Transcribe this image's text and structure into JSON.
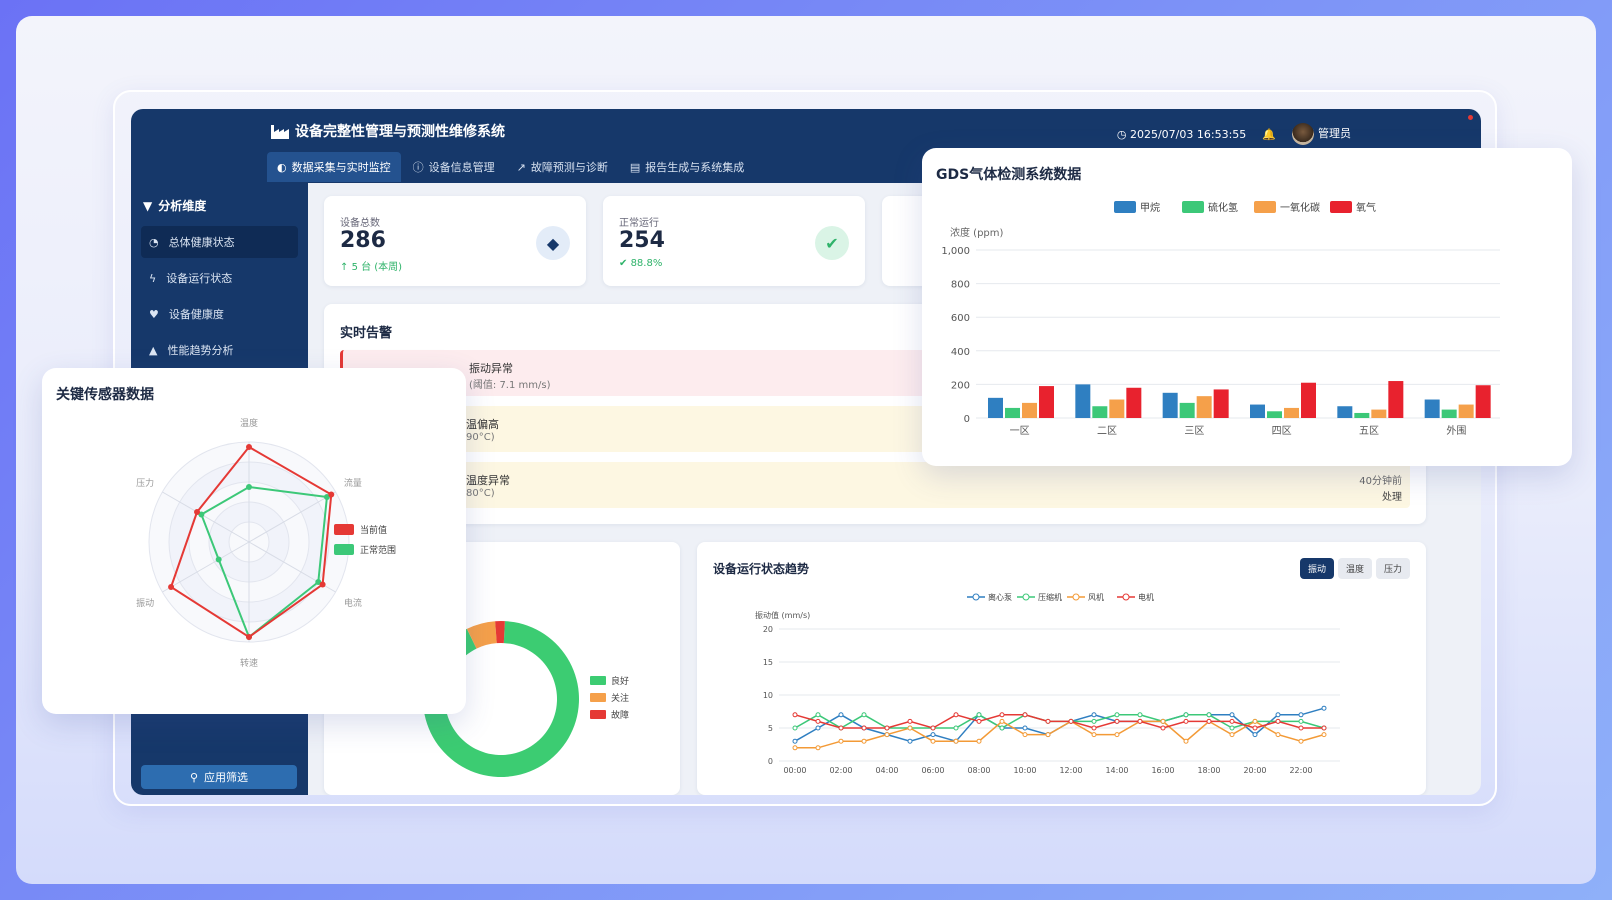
{
  "app": {
    "title": "设备完整性管理与预测性维修系统",
    "datetime": "2025/07/03 16:53:55",
    "user": "管理员"
  },
  "tabs": [
    {
      "label": "数据采集与实时监控",
      "icon": "dashboard-icon",
      "active": true
    },
    {
      "label": "设备信息管理",
      "icon": "info-icon"
    },
    {
      "label": "故障预测与诊断",
      "icon": "line-chart-icon"
    },
    {
      "label": "报告生成与系统集成",
      "icon": "document-icon"
    }
  ],
  "sidebar": {
    "title": "分析维度",
    "items": [
      {
        "label": "总体健康状态",
        "icon": "gauge-icon",
        "active": true
      },
      {
        "label": "设备运行状态",
        "icon": "bolt-icon"
      },
      {
        "label": "设备健康度",
        "icon": "heartbeat-icon"
      },
      {
        "label": "性能趋势分析",
        "icon": "area-chart-icon"
      }
    ],
    "apply_button": "应用筛选"
  },
  "stats": [
    {
      "label": "设备总数",
      "value": "286",
      "sub": "5 台 (本周)",
      "icon": "cubes-icon"
    },
    {
      "label": "正常运行",
      "value": "254",
      "sub": "88.8%",
      "icon": "check-icon"
    }
  ],
  "alerts": {
    "title": "实时告警",
    "items": [
      {
        "title": "振动异常",
        "detail": "(阈值: 7.1 mm/s)",
        "time": "",
        "action": "",
        "color": "#fdecee"
      },
      {
        "title": "温偏高",
        "detail": "90°C)",
        "time": "",
        "action": "",
        "color": "#fdf7e2"
      },
      {
        "title": "温度异常",
        "detail": "80°C)",
        "time": "40分钟前",
        "action": "处理",
        "color": "#fdf7e2"
      }
    ]
  },
  "donut": {
    "legend": [
      "良好",
      "关注",
      "故障"
    ],
    "values": [
      92,
      6,
      2
    ],
    "colors": [
      "#3ccc72",
      "#f5a04a",
      "#e53935"
    ]
  },
  "trend": {
    "title": "设备运行状态趋势",
    "buttons": [
      "振动",
      "温度",
      "压力"
    ],
    "ylabel": "振动值 (mm/s)",
    "ylim": [
      0,
      20
    ],
    "yticks": [
      "0",
      "5",
      "10",
      "15",
      "20"
    ],
    "xticks": [
      "00:00",
      "02:00",
      "04:00",
      "06:00",
      "08:00",
      "10:00",
      "12:00",
      "14:00",
      "16:00",
      "18:00",
      "20:00",
      "22:00"
    ],
    "series": [
      {
        "name": "离心泵",
        "color": "#2f7fc1",
        "values": [
          3,
          5,
          7,
          5,
          4,
          3,
          4,
          3,
          7,
          5,
          5,
          4,
          6,
          7,
          6,
          6,
          6,
          7,
          7,
          7,
          4,
          7,
          7,
          8
        ]
      },
      {
        "name": "压缩机",
        "color": "#3cc878",
        "values": [
          5,
          7,
          5,
          7,
          5,
          5,
          5,
          5,
          7,
          5,
          7,
          6,
          6,
          6,
          7,
          7,
          6,
          7,
          7,
          5,
          6,
          6,
          6,
          5
        ]
      },
      {
        "name": "风机",
        "color": "#f39a36",
        "values": [
          2,
          2,
          3,
          3,
          4,
          5,
          3,
          3,
          3,
          6,
          4,
          4,
          6,
          4,
          4,
          6,
          6,
          3,
          6,
          4,
          6,
          4,
          3,
          4
        ]
      },
      {
        "name": "电机",
        "color": "#e53935",
        "values": [
          7,
          6,
          5,
          5,
          5,
          6,
          5,
          7,
          6,
          7,
          7,
          6,
          6,
          5,
          6,
          6,
          5,
          6,
          6,
          6,
          5,
          6,
          5,
          5
        ]
      }
    ]
  },
  "gds": {
    "title": "GDS气体检测系统数据",
    "ylabel": "浓度 (ppm)",
    "ylim": [
      0,
      1000
    ],
    "yticks": [
      "0",
      "200",
      "400",
      "600",
      "800",
      "1,000"
    ],
    "chart_data": {
      "type": "bar",
      "categories": [
        "一区",
        "二区",
        "三区",
        "四区",
        "五区",
        "外围"
      ],
      "ylabel": "浓度 (ppm)",
      "ylim": [
        0,
        1000
      ],
      "series": [
        {
          "name": "甲烷",
          "color": "#2f7fc1",
          "values": [
            120,
            200,
            150,
            80,
            70,
            110
          ]
        },
        {
          "name": "硫化氢",
          "color": "#3cc878",
          "values": [
            60,
            70,
            90,
            40,
            30,
            50
          ]
        },
        {
          "name": "一氧化碳",
          "color": "#f5a04a",
          "values": [
            90,
            110,
            130,
            60,
            50,
            80
          ]
        },
        {
          "name": "氧气",
          "color": "#e8222e",
          "values": [
            190,
            180,
            170,
            210,
            220,
            195
          ]
        }
      ]
    }
  },
  "radar": {
    "title": "关键传感器数据",
    "axes": [
      "温度",
      "流量",
      "电流",
      "转速",
      "振动",
      "压力"
    ],
    "legend": [
      "当前值",
      "正常范围"
    ],
    "current": [
      0.95,
      0.95,
      0.85,
      0.95,
      0.9,
      0.6
    ],
    "normal": [
      0.55,
      0.9,
      0.8,
      0.95,
      0.35,
      0.55
    ],
    "colors": [
      "#e53935",
      "#3cc878"
    ]
  }
}
